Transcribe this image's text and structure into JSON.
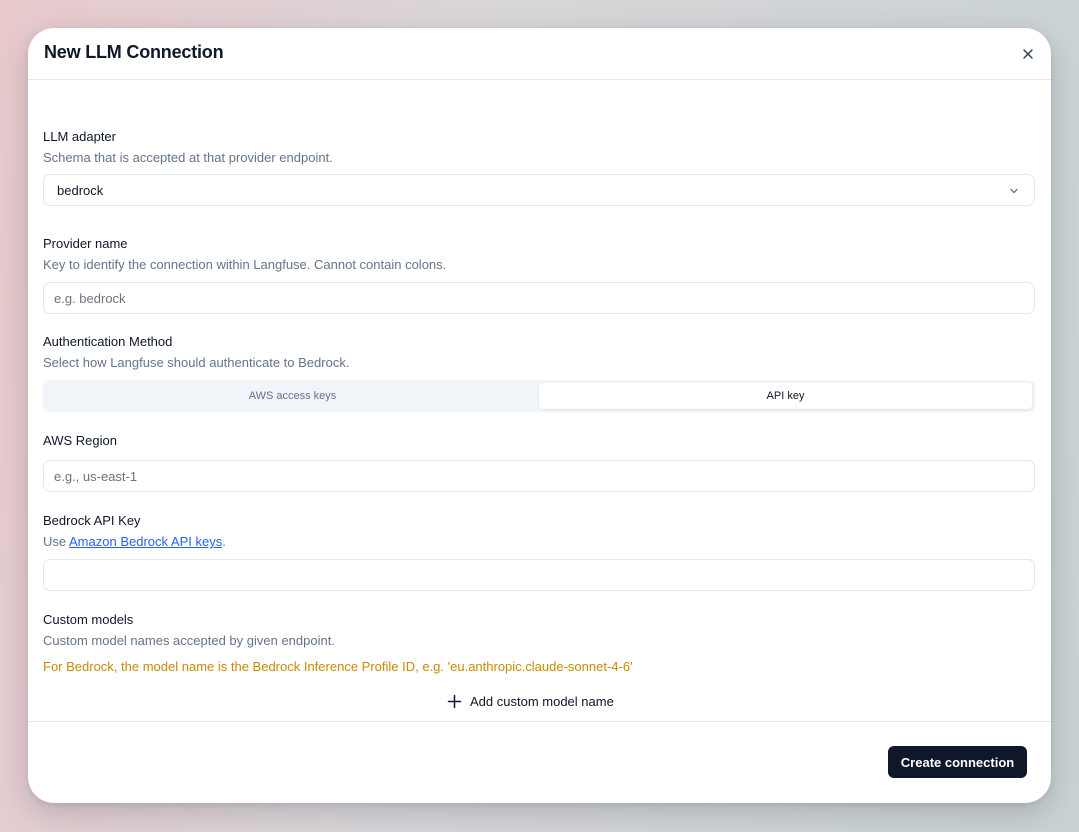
{
  "dialog": {
    "title": "New LLM Connection"
  },
  "adapter": {
    "label": "LLM adapter",
    "description": "Schema that is accepted at that provider endpoint.",
    "value": "bedrock"
  },
  "provider_name": {
    "label": "Provider name",
    "description": "Key to identify the connection within Langfuse. Cannot contain colons.",
    "placeholder": "e.g. bedrock",
    "value": ""
  },
  "auth": {
    "label": "Authentication Method",
    "description": "Select how Langfuse should authenticate to Bedrock.",
    "options": [
      "AWS access keys",
      "API key"
    ],
    "selected": "API key"
  },
  "region": {
    "label": "AWS Region",
    "placeholder": "e.g., us-east-1",
    "value": ""
  },
  "api_key": {
    "label": "Bedrock API Key",
    "description_prefix": "Use ",
    "description_link": "Amazon Bedrock API keys",
    "description_suffix": ".",
    "value": ""
  },
  "custom_models": {
    "label": "Custom models",
    "description": "Custom model names accepted by given endpoint.",
    "hint": "For Bedrock, the model name is the Bedrock Inference Profile ID, e.g. 'eu.anthropic.claude-sonnet-4-6'",
    "add_label": "Add custom model name"
  },
  "footer": {
    "create_label": "Create connection"
  },
  "icons": {
    "close": "close-icon",
    "dropdown": "chevron-down-icon",
    "add": "plus-icon"
  }
}
